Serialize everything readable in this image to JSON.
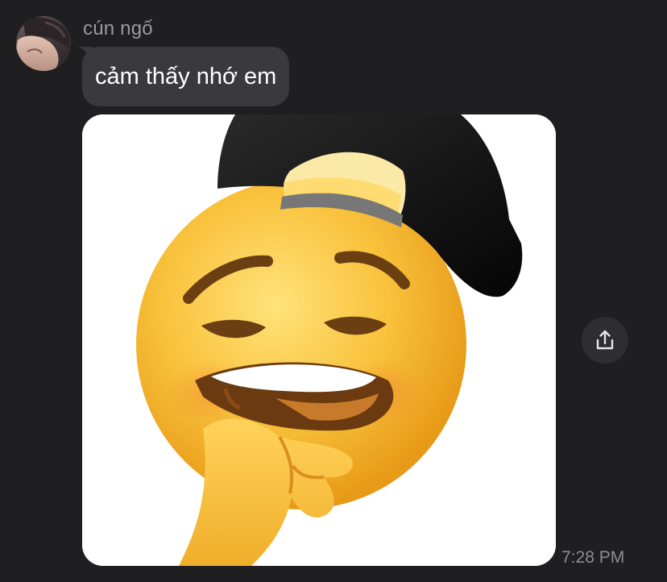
{
  "message": {
    "sender_name": "cún ngố",
    "text": "cảm thấy nhớ em",
    "timestamp": "7:28 PM"
  },
  "avatar": {
    "icon": "profile-photo"
  },
  "attachment": {
    "icon": "thinking-emoji-with-backwards-cap"
  },
  "actions": {
    "share_icon": "share-icon"
  },
  "colors": {
    "background": "#1f1f21",
    "bubble": "#3a3a3c",
    "secondary_text": "#9a9a9e",
    "emoji_face": "#f7c234",
    "cap": "#111111"
  }
}
